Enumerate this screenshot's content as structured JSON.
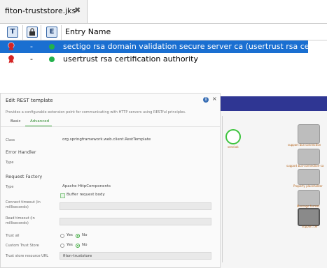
{
  "keystore": {
    "tab_title": "fiton-truststore.jks",
    "tab_close": "✖",
    "columns": {
      "type": "T",
      "lock": "",
      "expiry": "E",
      "name": "Entry Name"
    },
    "entries": [
      {
        "lock": "-",
        "name": "sectigo rsa domain validation secure server ca (usertrust rsa certificat…",
        "selected": true
      },
      {
        "lock": "-",
        "name": "usertrust rsa certification authority",
        "selected": false
      }
    ]
  },
  "dialog": {
    "title": "Edit REST template",
    "info_icon": "i",
    "close_icon": "×",
    "description": "Provides a configurable extension point for communicating with HTTP servers using RESTful principles.",
    "tabs": [
      {
        "label": "Basic"
      },
      {
        "label": "Advanced"
      }
    ],
    "class_label": "Class",
    "class_value": "org.springframework.web.client.RestTemplate",
    "error_handler_section": "Error Handler",
    "error_type_label": "Type",
    "request_factory_section": "Request Factory",
    "request_type_label": "Type",
    "request_type_value": "Apache HttpComponents",
    "buffer_label": "Buffer request body",
    "connect_timeout_label_1": "Connect timeout (in",
    "connect_timeout_label_2": "milliseconds)",
    "read_timeout_label_1": "Read timeout (in",
    "read_timeout_label_2": "milliseconds)",
    "trust_all_label": "Trust all",
    "custom_trust_label": "Custom Trust Store",
    "yes": "Yes",
    "no": "No",
    "trust_store_label": "Trust store resource URL",
    "trust_store_value": "fiton-truststore"
  },
  "canvas": {
    "circle_label": "send.ok",
    "nodes": [
      "support bus-connection",
      "support bus-connection-ca",
      "Property placeholder",
      "Message format",
      "support.cer"
    ]
  }
}
